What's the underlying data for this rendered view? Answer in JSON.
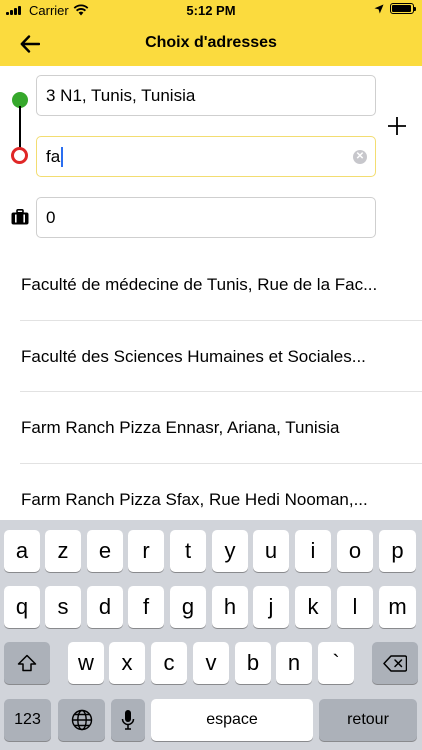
{
  "status_bar": {
    "carrier": "Carrier",
    "time": "5:12 PM",
    "battery_level": 0.95
  },
  "nav": {
    "title": "Choix d'adresses",
    "back_icon": "arrow-left-icon",
    "background": "#fbdb3e"
  },
  "form": {
    "from_value": "3 N1, Tunis, Tunisia",
    "to_value": "fa",
    "bags_value": "0",
    "start_color": "#36a82c",
    "end_color": "#e02727",
    "add_icon": "plus-icon",
    "clear_icon": "clear-icon",
    "luggage_icon": "luggage-icon"
  },
  "suggestions": [
    {
      "label": "Faculté de médecine de Tunis, Rue de la Fac..."
    },
    {
      "label": "Faculté des Sciences Humaines et Sociales..."
    },
    {
      "label": "Farm Ranch Pizza Ennasr, Ariana, Tunisia"
    },
    {
      "label": "Farm Ranch Pizza Sfax, Rue Hedi Nooman,..."
    }
  ],
  "keyboard": {
    "row1": [
      "a",
      "z",
      "e",
      "r",
      "t",
      "y",
      "u",
      "i",
      "o",
      "p"
    ],
    "row2": [
      "q",
      "s",
      "d",
      "f",
      "g",
      "h",
      "j",
      "k",
      "l",
      "m"
    ],
    "row3": [
      "w",
      "x",
      "c",
      "v",
      "b",
      "n",
      "`"
    ],
    "numbers_label": "123",
    "space_label": "espace",
    "return_label": "retour"
  }
}
